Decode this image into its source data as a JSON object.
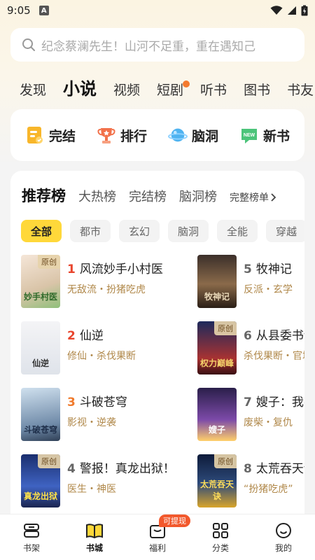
{
  "status_bar": {
    "time": "9:05",
    "a_label": "A"
  },
  "search": {
    "placeholder": "纪念蔡澜先生！山河不足重，重在遇知己"
  },
  "tabs": [
    {
      "label": "发现"
    },
    {
      "label": "小说",
      "active": true
    },
    {
      "label": "视频"
    },
    {
      "label": "短剧",
      "dot": true
    },
    {
      "label": "听书"
    },
    {
      "label": "图书"
    },
    {
      "label": "书友"
    }
  ],
  "quick_entries": [
    {
      "label": "完结",
      "icon": "completed-icon"
    },
    {
      "label": "排行",
      "icon": "trophy-icon"
    },
    {
      "label": "脑洞",
      "icon": "planet-icon"
    },
    {
      "label": "新书",
      "icon": "new-book-icon"
    }
  ],
  "ranking": {
    "tabs": [
      "推荐榜",
      "大热榜",
      "完结榜",
      "脑洞榜"
    ],
    "more_label": "完整榜单",
    "chips": [
      "全部",
      "都市",
      "玄幻",
      "脑洞",
      "全能",
      "穿越"
    ],
    "books": [
      {
        "rank": "1",
        "title": "风流妙手小村医",
        "tags": "无敌流・扮猪吃虎",
        "tag": "原创",
        "cover_text": "妙手村医",
        "rank_color": "#e8452d"
      },
      {
        "rank": "2",
        "title": "仙逆",
        "tags": "修仙・杀伐果断",
        "tag": "",
        "cover_text": "仙逆",
        "rank_color": "#e8452d"
      },
      {
        "rank": "3",
        "title": "斗破苍穹",
        "tags": "影视・逆袭",
        "tag": "",
        "cover_text": "斗破苍穹",
        "rank_color": "#f07a2c"
      },
      {
        "rank": "4",
        "title": "警报！真龙出狱！",
        "tags": "医生・神医",
        "tag": "原创",
        "cover_text": "真龙出狱",
        "rank_color": "#666666"
      },
      {
        "rank": "5",
        "title": "牧神记",
        "tags": "反派・玄学",
        "tag": "",
        "cover_text": "牧神记",
        "rank_color": "#666666"
      },
      {
        "rank": "6",
        "title": "从县委书记到权力巅峰",
        "tags": "杀伐果断・官场",
        "tag": "原创",
        "cover_text": "权力巅峰",
        "rank_color": "#666666"
      },
      {
        "rank": "7",
        "title": "嫂子：我不想努力了",
        "tags": "废柴・复仇",
        "tag": "",
        "cover_text": "嫂子",
        "rank_color": "#666666"
      },
      {
        "rank": "8",
        "title": "太荒吞天诀",
        "tags": "“扮猪吃虎”",
        "tag": "原创",
        "cover_text": "太荒吞天诀",
        "rank_color": "#666666"
      }
    ]
  },
  "bottom_nav": [
    {
      "label": "书架",
      "icon": "bookshelf-icon"
    },
    {
      "label": "书城",
      "icon": "bookstore-icon",
      "active": true
    },
    {
      "label": "福利",
      "icon": "gift-icon",
      "badge": "可提现"
    },
    {
      "label": "分类",
      "icon": "category-icon"
    },
    {
      "label": "我的",
      "icon": "profile-icon"
    }
  ],
  "colors": {
    "accent": "#ffd83a",
    "tag_text": "#b0884a",
    "rank_red": "#e8452d"
  }
}
